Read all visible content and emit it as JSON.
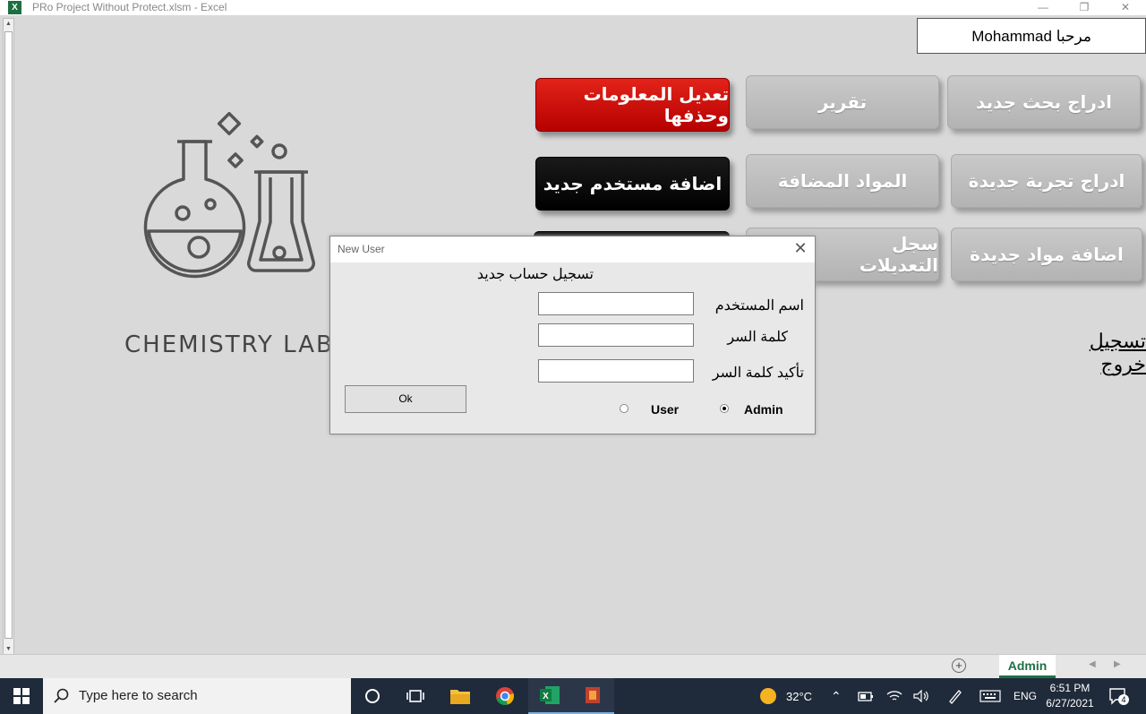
{
  "window": {
    "title": "PRo Project Without Protect.xlsm - Excel",
    "app_icon_letter": "X",
    "minimize": "—",
    "restore": "❐",
    "close": "✕"
  },
  "header": {
    "welcome": "مرحبا Mohammad"
  },
  "buttons": {
    "edit_delete": "تعديل المعلومات وحذفها",
    "report": "تقرير",
    "insert_research": "ادراج بحث جديد",
    "add_user": "اضافة مستخدم جديد",
    "added_materials": "المواد المضافة",
    "insert_experiment": "ادراج تجربة جديدة",
    "edit_log": "سجل التعديلات",
    "add_materials": "اضافة مواد جديدة"
  },
  "logout": "تسجيل خروج",
  "logo": {
    "text": "CHEMISTRY LAB"
  },
  "dialog": {
    "title": "New User",
    "close": "✕",
    "heading": "تسجيل حساب جديد",
    "username_label": "اسم المستخدم",
    "password_label": "كلمة السر",
    "confirm_label": "تأكيد كلمة السر",
    "username_value": "",
    "password_value": "",
    "confirm_value": "",
    "ok": "Ok",
    "radio_user": "User",
    "radio_admin": "Admin",
    "selected_role": "Admin"
  },
  "sheets": {
    "add": "+",
    "active_tab": "Admin",
    "prev": "◀",
    "next": "▶"
  },
  "taskbar": {
    "search_placeholder": "Type here to search",
    "weather": "32°C",
    "language": "ENG",
    "time": "6:51 PM",
    "date": "6/27/2021",
    "notifications": "4"
  },
  "colors": {
    "excel_green": "#1e7145",
    "red_button": "#d40f0f",
    "gray_button": "#bdbdbd"
  }
}
